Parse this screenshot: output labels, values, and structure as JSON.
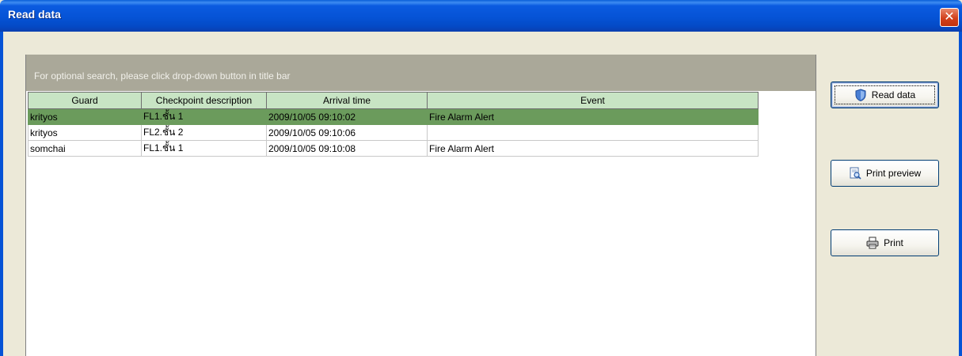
{
  "window": {
    "title": "Read data",
    "close_glyph": "✕"
  },
  "hint": "For optional search, please click drop-down button in title bar",
  "table": {
    "columns": [
      "Guard",
      "Checkpoint description",
      "Arrival time",
      "Event"
    ],
    "rows": [
      [
        "krityos",
        "FL1.ชั้น 1",
        "2009/10/05 09:10:02",
        "Fire Alarm Alert"
      ],
      [
        "krityos",
        "FL2.ชั้น 2",
        "2009/10/05 09:10:06",
        ""
      ],
      [
        "somchai",
        "FL1.ชั้น 1",
        "2009/10/05 09:10:08",
        "Fire Alarm Alert"
      ]
    ],
    "selected_row": 0
  },
  "buttons": {
    "read": {
      "label": "Read data",
      "icon": "shield-icon"
    },
    "preview": {
      "label": "Print preview",
      "icon": "print-preview-icon"
    },
    "print": {
      "label": "Print",
      "icon": "printer-icon"
    }
  },
  "colors": {
    "title_bar": "#0553d6",
    "header_bg": "#c8e4c4",
    "selected_row": "#6b9b5c",
    "hint_bar": "#aaa899"
  }
}
